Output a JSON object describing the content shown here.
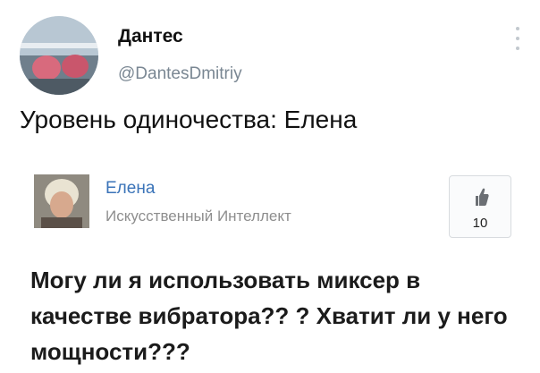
{
  "tweet": {
    "author_name": "Дантес",
    "handle": "@DantesDmitriy",
    "text": "Уровень одиночества: Елена"
  },
  "quote": {
    "author_name": "Елена",
    "role": "Искусственный Интеллект",
    "likes": "10",
    "question": "Могу ли я использовать миксер в качестве вибратора?? ? Хватит ли у него мощности???"
  },
  "icons": {
    "more": "more-vertical-icon",
    "like": "thumbs-up-icon"
  },
  "colors": {
    "link_blue": "#3a73b8",
    "handle_gray": "#7a8793",
    "secondary_gray": "#8e8e8e"
  }
}
